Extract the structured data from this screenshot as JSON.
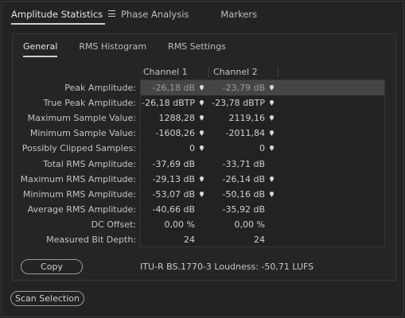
{
  "top_tabs": [
    {
      "label": "Amplitude Statistics",
      "active": true
    },
    {
      "label": "Phase Analysis",
      "active": false
    },
    {
      "label": "Markers",
      "active": false
    }
  ],
  "sub_tabs": [
    {
      "label": "General",
      "active": true
    },
    {
      "label": "RMS Histogram",
      "active": false
    },
    {
      "label": "RMS Settings",
      "active": false
    }
  ],
  "columns": [
    "Channel 1",
    "Channel 2"
  ],
  "rows": [
    {
      "label": "Peak Amplitude:",
      "ch1": "-26,18 dB",
      "ch2": "-23,79 dB",
      "pin": true,
      "selected": true
    },
    {
      "label": "True Peak Amplitude:",
      "ch1": "-26,18 dBTP",
      "ch2": "-23,78 dBTP",
      "pin": true,
      "selected": false
    },
    {
      "label": "Maximum Sample Value:",
      "ch1": "1288,28",
      "ch2": "2119,16",
      "pin": true,
      "selected": false
    },
    {
      "label": "Minimum Sample Value:",
      "ch1": "-1608,26",
      "ch2": "-2011,84",
      "pin": true,
      "selected": false
    },
    {
      "label": "Possibly Clipped Samples:",
      "ch1": "0",
      "ch2": "0",
      "pin": true,
      "selected": false
    },
    {
      "label": "Total RMS Amplitude:",
      "ch1": "-37,69 dB",
      "ch2": "-33,71 dB",
      "pin": false,
      "selected": false
    },
    {
      "label": "Maximum RMS Amplitude:",
      "ch1": "-29,13 dB",
      "ch2": "-26,14 dB",
      "pin": true,
      "selected": false
    },
    {
      "label": "Minimum RMS Amplitude:",
      "ch1": "-53,07 dB",
      "ch2": "-50,16 dB",
      "pin": true,
      "selected": false
    },
    {
      "label": "Average RMS Amplitude:",
      "ch1": "-40,66 dB",
      "ch2": "-35,92 dB",
      "pin": false,
      "selected": false
    },
    {
      "label": "DC Offset:",
      "ch1": "0,00 %",
      "ch2": "0,00 %",
      "pin": false,
      "selected": false
    },
    {
      "label": "Measured Bit Depth:",
      "ch1": "24",
      "ch2": "24",
      "pin": false,
      "selected": false
    }
  ],
  "pin_icon": "location-pin-icon",
  "menu_icon": "hamburger-menu-icon",
  "copy_label": "Copy",
  "loudness_text": "ITU-R BS.1770-3 Loudness:  -50,71 LUFS",
  "scan_label": "Scan Selection",
  "colors": {
    "background": "#232323",
    "selected_row": "#454545",
    "text": "#c2c2c2"
  }
}
